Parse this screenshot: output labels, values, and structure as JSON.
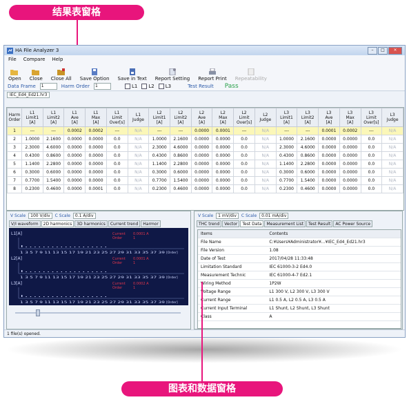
{
  "callouts": {
    "top": "结果表窗格",
    "bottom": "图表和数据窗格"
  },
  "window": {
    "title": "HA File Analyzer 3"
  },
  "menu": [
    "File",
    "Compare",
    "Help"
  ],
  "toolbar": [
    {
      "label": "Open",
      "icon": "folder-open-icon",
      "disabled": false
    },
    {
      "label": "Close",
      "icon": "folder-icon",
      "disabled": false
    },
    {
      "label": "Close All",
      "icon": "folder-stack-icon",
      "disabled": false
    },
    {
      "label": "Save Option",
      "icon": "save-icon",
      "disabled": false
    },
    {
      "label": "Save in Text",
      "icon": "save-text-icon",
      "disabled": false
    },
    {
      "label": "Report Setting",
      "icon": "report-settings-icon",
      "disabled": false
    },
    {
      "label": "Report Print",
      "icon": "printer-icon",
      "disabled": false
    },
    {
      "label": "Repeatability",
      "icon": "repeat-icon",
      "disabled": true
    }
  ],
  "options": {
    "data_frame_label": "Data Frame",
    "data_frame_value": "1",
    "harm_order_label": "Harm Order",
    "harm_order_value": "1",
    "l1": "L1",
    "l2": "L2",
    "l3": "L3",
    "test_result_label": "Test Result",
    "test_result_value": "Pass"
  },
  "file_tab": "IEC_Ed4_Ed21.hr3",
  "results": {
    "headers": [
      [
        "Harm",
        "Order"
      ],
      [
        "L1",
        "Limit1",
        "[A]"
      ],
      [
        "L1",
        "Limit2",
        "[A]"
      ],
      [
        "L1",
        "Ave",
        "[A]"
      ],
      [
        "L1",
        "Max",
        "[A]"
      ],
      [
        "L1",
        "Limit",
        "Over[s]"
      ],
      [
        "L1",
        "Judge"
      ],
      [
        "L2",
        "Limit1",
        "[A]"
      ],
      [
        "L2",
        "Limit2",
        "[A]"
      ],
      [
        "L2",
        "Ave",
        "[A]"
      ],
      [
        "L2",
        "Max",
        "[A]"
      ],
      [
        "L2",
        "Limit",
        "Over[s]"
      ],
      [
        "L2",
        "Judge"
      ],
      [
        "L3",
        "Limit1",
        "[A]"
      ],
      [
        "L3",
        "Limit2",
        "[A]"
      ],
      [
        "L3",
        "Ave",
        "[A]"
      ],
      [
        "L3",
        "Max",
        "[A]"
      ],
      [
        "L3",
        "Limit",
        "Over[s]"
      ],
      [
        "L3",
        "Judge"
      ]
    ],
    "rows": [
      [
        "1",
        "---",
        "---",
        "0.0002",
        "0.0002",
        "---",
        "N/A",
        "---",
        "---",
        "0.0000",
        "0.0001",
        "---",
        "N/A",
        "---",
        "---",
        "0.0001",
        "0.0002",
        "---",
        "N/A"
      ],
      [
        "2",
        "1.0000",
        "2.1600",
        "0.0000",
        "0.0000",
        "0.0",
        "N/A",
        "1.0000",
        "2.1600",
        "0.0000",
        "0.0000",
        "0.0",
        "N/A",
        "1.0000",
        "2.1600",
        "0.0000",
        "0.0000",
        "0.0",
        "N/A"
      ],
      [
        "3",
        "2.3000",
        "4.6000",
        "0.0000",
        "0.0000",
        "0.0",
        "N/A",
        "2.3000",
        "4.6000",
        "0.0000",
        "0.0000",
        "0.0",
        "N/A",
        "2.3000",
        "4.6000",
        "0.0000",
        "0.0000",
        "0.0",
        "N/A"
      ],
      [
        "4",
        "0.4300",
        "0.8600",
        "0.0000",
        "0.0000",
        "0.0",
        "N/A",
        "0.4300",
        "0.8600",
        "0.0000",
        "0.0000",
        "0.0",
        "N/A",
        "0.4300",
        "0.8600",
        "0.0000",
        "0.0000",
        "0.0",
        "N/A"
      ],
      [
        "5",
        "1.1400",
        "2.2800",
        "0.0000",
        "0.0000",
        "0.0",
        "N/A",
        "1.1400",
        "2.2800",
        "0.0000",
        "0.0000",
        "0.0",
        "N/A",
        "1.1400",
        "2.2800",
        "0.0000",
        "0.0000",
        "0.0",
        "N/A"
      ],
      [
        "6",
        "0.3000",
        "0.6000",
        "0.0000",
        "0.0000",
        "0.0",
        "N/A",
        "0.3000",
        "0.6000",
        "0.0000",
        "0.0000",
        "0.0",
        "N/A",
        "0.3000",
        "0.6000",
        "0.0000",
        "0.0000",
        "0.0",
        "N/A"
      ],
      [
        "7",
        "0.7700",
        "1.5400",
        "0.0000",
        "0.0000",
        "0.0",
        "N/A",
        "0.7700",
        "1.5400",
        "0.0000",
        "0.0000",
        "0.0",
        "N/A",
        "0.7700",
        "1.5400",
        "0.0000",
        "0.0000",
        "0.0",
        "N/A"
      ],
      [
        "8",
        "0.2300",
        "0.4600",
        "0.0000",
        "0.0001",
        "0.0",
        "N/A",
        "0.2300",
        "0.4600",
        "0.0000",
        "0.0000",
        "0.0",
        "N/A",
        "0.2300",
        "0.4600",
        "0.0000",
        "0.0000",
        "0.0",
        "N/A"
      ]
    ]
  },
  "left_pane": {
    "vscale_label": "V Scale",
    "vscale_value": "100 V/div",
    "cscale_label": "C Scale",
    "cscale_value": "0.1 A/div",
    "tabs": [
      "V/I waveform",
      "2D harmonics",
      "3D harmonics",
      "Current trend",
      "Harmor"
    ],
    "active_tab": 1,
    "plots": [
      {
        "label": "L1[A]",
        "current_label": "Current",
        "current_value": "0.0001 A",
        "order_label": "Order",
        "order_value": "1"
      },
      {
        "label": "L2[A]",
        "current_label": "Current",
        "current_value": "0.0001 A",
        "order_label": "Order",
        "order_value": "1"
      },
      {
        "label": "L3[A]",
        "current_label": "Current",
        "current_value": "0.0002 A",
        "order_label": "Order",
        "order_value": "1"
      }
    ],
    "xticks": "1 3 5 7 9 11 13 15 17 19 21 23 25 27 29 31 33 35 37 39",
    "order_tag": "[Order]"
  },
  "right_pane": {
    "vscale_label": "V Scale",
    "vscale_value": "1 mV/div",
    "cscale_label": "C Scale",
    "cscale_value": "0.01 mA/div",
    "tabs": [
      "THC trend",
      "Vector",
      "Test Data",
      "Measurement List",
      "Test Result",
      "AC Power Source"
    ],
    "active_tab": 2,
    "columns": [
      "Items",
      "Contents"
    ],
    "rows": [
      [
        "File Name",
        "C:¥Users¥Administrator¥...¥IEC_Ed4_Ed21.hr3"
      ],
      [
        "File Version",
        "1.08"
      ],
      [
        "Date of Test",
        "2017/04/28 11:33:48"
      ],
      [
        "Limitation Standard",
        "IEC 61000-3-2 Ed4.0"
      ],
      [
        "Measurement Technic",
        "IEC 61000-4-7 Ed2.1"
      ],
      [
        "Wiring Method",
        "1P2W"
      ],
      [
        "Voltage Range",
        "L1 300 V, L2 300 V, L3 300 V"
      ],
      [
        "Current Range",
        "L1 0.5 A, L2 0.5 A, L3 0.5 A"
      ],
      [
        "Current Input Terminal",
        "L1 Shunt, L2 Shunt, L3 Shunt"
      ],
      [
        "Class",
        "A"
      ]
    ]
  },
  "status": "1 file(s) opened.",
  "colors": {
    "accent": "#e8157c",
    "plot_bg": "#0f1846",
    "pass": "#2aa14a",
    "current_text": "#e0354b"
  }
}
